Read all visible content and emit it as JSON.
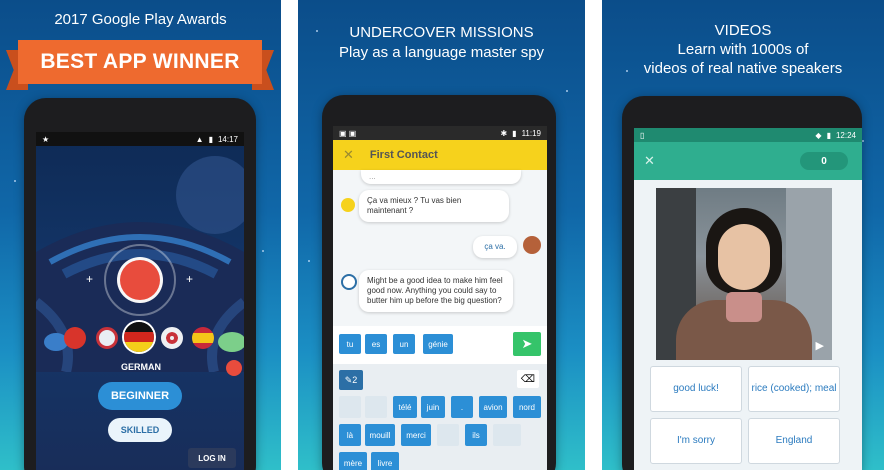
{
  "panel1": {
    "caption": "2017 Google Play Awards",
    "ribbon": "BEST APP WINNER",
    "time": "14:17",
    "language": "GERMAN",
    "beginner": "BEGINNER",
    "skilled": "SKILLED",
    "login": "LOG IN"
  },
  "panel2": {
    "caption_line1": "UNDERCOVER MISSIONS",
    "caption_line2": "Play as a language master spy",
    "time": "11:19",
    "header_title": "First Contact",
    "cut_text": "...",
    "msg1": "Ça va mieux ? Tu vas bien maintenant ?",
    "reply": "ça va.",
    "msg2": "Might be a good idea to make him feel good now. Anything you could say to butter him up before the big question?",
    "answer_words": [
      "tu",
      "es",
      "un",
      "génie"
    ],
    "keyboard_words": [
      "télé",
      "juin",
      ".",
      "avion",
      "nord",
      "là",
      "mouill",
      "merci",
      "ils",
      "mère",
      "livre"
    ],
    "shift_label": "2"
  },
  "panel3": {
    "caption_line1": "VIDEOS",
    "caption_line2": "Learn with 1000s of",
    "caption_line3": "videos of real native speakers",
    "time": "12:24",
    "score": "0",
    "answers": [
      "good luck!",
      "rice (cooked); meal",
      "I'm sorry",
      "England"
    ]
  },
  "colors": {
    "orange": "#ee6a2f",
    "yellow": "#f6d21c",
    "teal": "#2fae8f",
    "blue": "#2c8fd6",
    "green": "#35c46a"
  }
}
